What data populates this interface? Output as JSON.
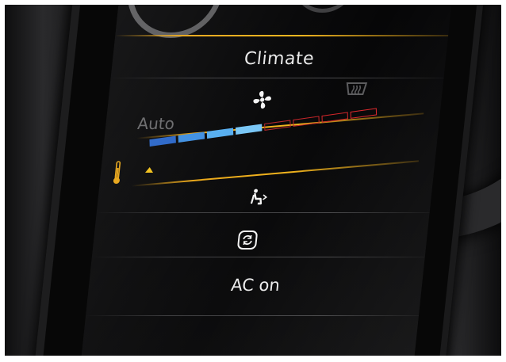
{
  "screen": {
    "title": "Climate",
    "mode_label": "Auto",
    "ac_label": "AC on",
    "icons": {
      "fan": "fan-icon",
      "defrost": "rear-defrost-icon",
      "temperature": "thermometer-icon",
      "airflow": "air-distribution-icon",
      "recirculation": "air-recirculation-icon"
    },
    "temperature": {
      "cold_segments": 4,
      "hot_segments": 4,
      "level": 0.5
    }
  },
  "colors": {
    "accent_yellow": "#f0b01a",
    "cold_blue": "#3f9ae8",
    "hot_red": "#d6262a",
    "text": "#e9e9e9",
    "inactive_text": "#6a6a6c"
  }
}
